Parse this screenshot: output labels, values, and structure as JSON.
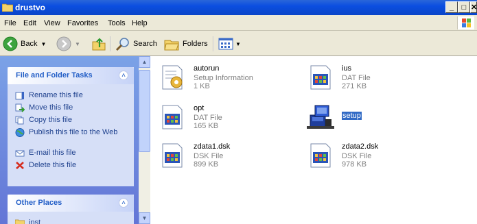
{
  "window": {
    "title": "drustvo"
  },
  "window_buttons": {
    "minimize": "_",
    "maximize": "□",
    "close": "✕"
  },
  "menu": [
    "File",
    "Edit",
    "View",
    "Favorites",
    "Tools",
    "Help"
  ],
  "toolbar": {
    "back": "Back",
    "search": "Search",
    "folders": "Folders"
  },
  "tasks_panel": {
    "title": "File and Folder Tasks",
    "collapse": "˄",
    "items": [
      "Rename this file",
      "Move this file",
      "Copy this file",
      "Publish this file to the Web",
      "E-mail this file",
      "Delete this file"
    ]
  },
  "other_places": {
    "title": "Other Places",
    "collapse": "˄",
    "items": [
      "inst"
    ]
  },
  "files": [
    {
      "name": "autorun",
      "type": "Setup Information",
      "size": "1 KB"
    },
    {
      "name": "ius",
      "type": "DAT File",
      "size": "271 KB"
    },
    {
      "name": "opt",
      "type": "DAT File",
      "size": "165 KB"
    },
    {
      "name": "setup",
      "type": "",
      "size": ""
    },
    {
      "name": "zdata1.dsk",
      "type": "DSK File",
      "size": "899 KB"
    },
    {
      "name": "zdata2.dsk",
      "type": "DSK File",
      "size": "978 KB"
    }
  ],
  "colors": {
    "selection": "#316ac5",
    "titlebar": "#0b4ee0",
    "panel_bg": "#6375d6",
    "panel_text": "#21438f"
  }
}
